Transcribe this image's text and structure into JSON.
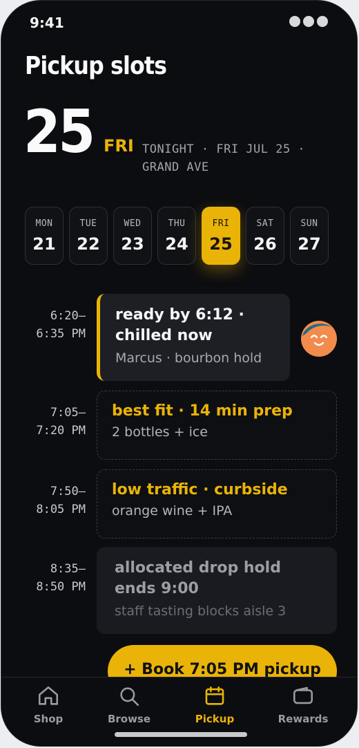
{
  "status": {
    "time": "9:41"
  },
  "header": {
    "title": "Pickup slots",
    "day_number": "25",
    "day_of_week": "FRI",
    "subtitle": "TONIGHT · FRI JUL 25 · GRAND AVE"
  },
  "week": [
    {
      "dow": "MON",
      "num": "21"
    },
    {
      "dow": "TUE",
      "num": "22"
    },
    {
      "dow": "WED",
      "num": "23"
    },
    {
      "dow": "THU",
      "num": "24"
    },
    {
      "dow": "FRI",
      "num": "25"
    },
    {
      "dow": "SAT",
      "num": "26"
    },
    {
      "dow": "SUN",
      "num": "27"
    }
  ],
  "selected_day": "FRI",
  "slots": [
    {
      "start": "6:20–",
      "end": "6:35 PM",
      "title": "ready by 6:12 · chilled now",
      "detail": "Marcus · bourbon hold",
      "state": "yours"
    },
    {
      "start": "7:05–",
      "end": "7:20 PM",
      "title": "best fit · 14 min prep",
      "detail": "2 bottles + ice",
      "state": "open"
    },
    {
      "start": "7:50–",
      "end": "8:05 PM",
      "title": "low traffic · curbside",
      "detail": "orange wine + IPA",
      "state": "open"
    },
    {
      "start": "8:35–",
      "end": "8:50 PM",
      "title": "allocated drop hold ends 9:00",
      "detail": "staff tasting blocks aisle 3",
      "state": "blocked"
    }
  ],
  "cta": {
    "label": "+ Book 7:05 PM pickup"
  },
  "tabs": [
    {
      "label": "Shop",
      "icon": "home-icon"
    },
    {
      "label": "Browse",
      "icon": "search-icon"
    },
    {
      "label": "Pickup",
      "icon": "calendar-icon",
      "active": true
    },
    {
      "label": "Rewards",
      "icon": "wallet-icon"
    }
  ],
  "colors": {
    "accent": "#eab308",
    "background": "#0c0d10",
    "card": "#1e1f25"
  }
}
